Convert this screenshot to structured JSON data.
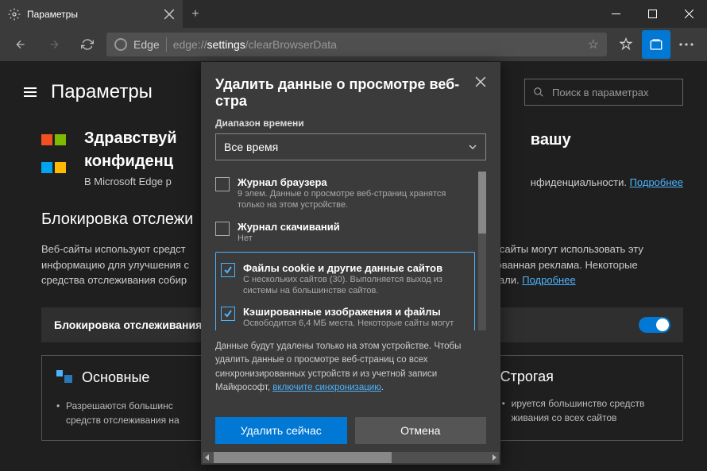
{
  "titlebar": {
    "tab_title": "Параметры"
  },
  "addrbar": {
    "edge_label": "Edge",
    "url_pre": "edge://",
    "url_hl": "settings",
    "url_post": "/clearBrowserData"
  },
  "page": {
    "title": "Параметры",
    "search_placeholder": "Поиск в параметрах",
    "greeting_line1": "Здравствуй",
    "greeting_line2": "конфиденц",
    "greeting_sub": "В Microsoft Edge р",
    "greeting_right": "нфиденциальности.",
    "greeting_right2": "вашу",
    "learn_more": "Подробнее",
    "section_title": "Блокировка отслежи",
    "section_desc_left": "Веб-сайты используют средст\nинформацию для улучшения с\nсредства отслеживания собир",
    "section_desc_right": "еб-сайты могут использовать эту\nированная реклама. Некоторые\nещали.",
    "tracking_label": "Блокировка отслеживания",
    "cards": [
      {
        "title": "Основные",
        "bullet": "Разрешаются большинс\nсредств отслеживания на"
      },
      {
        "title": "Строгая",
        "bullet": "ируется большинство средств\nживания со всех сайтов"
      }
    ]
  },
  "dialog": {
    "title": "Удалить данные о просмотре веб-стра",
    "drange_label": "Диапазон времени",
    "drange_value": "Все время",
    "items": [
      {
        "label": "Журнал браузера",
        "sub": "9 элем. Данные о просмотре веб-страниц хранятся только на этом устройстве.",
        "checked": false
      },
      {
        "label": "Журнал скачиваний",
        "sub": "Нет",
        "checked": false
      },
      {
        "label": "Файлы cookie и другие данные сайтов",
        "sub": "С нескольких сайтов (30). Выполняется выход из системы на большинстве сайтов.",
        "checked": true
      },
      {
        "label": "Кэшированные изображения и файлы",
        "sub": "Освободится 6,4 МБ места. Некоторые сайты могут",
        "checked": true
      }
    ],
    "note_pre": "Данные будут удалены только на этом устройстве. Чтобы удалить данные о просмотре веб-страниц со всех синхронизированных устройств и из учетной записи Майкрософт, ",
    "note_link": "включите синхронизацию",
    "btn_primary": "Удалить сейчас",
    "btn_secondary": "Отмена"
  }
}
